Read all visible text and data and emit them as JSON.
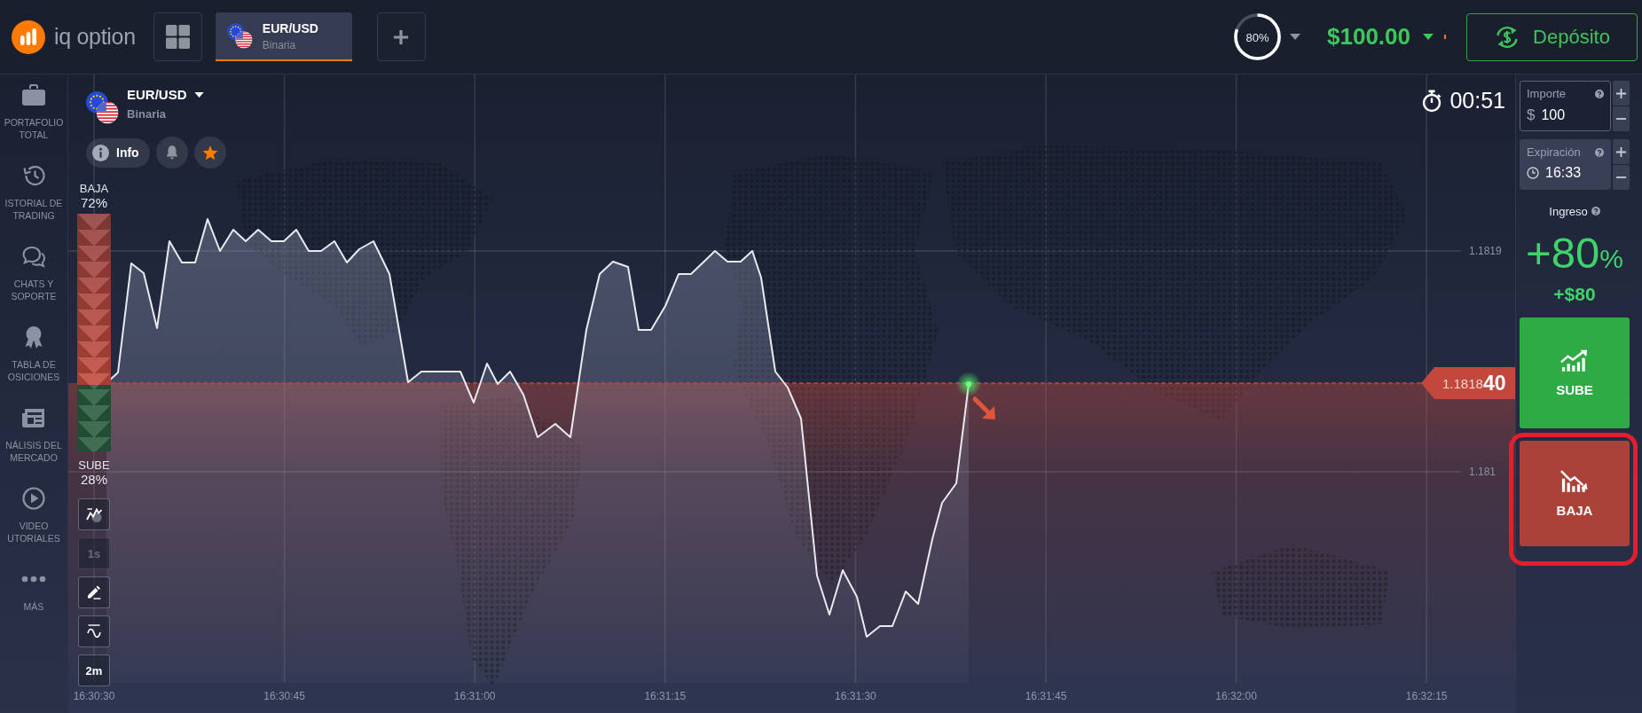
{
  "topbar": {
    "logo": "iq option",
    "tabs": [
      {
        "pair": "EUR/USD",
        "type": "Binaria",
        "selected": true
      }
    ],
    "ring": {
      "label": "80%",
      "level": 0.8
    },
    "balance": "$100.00",
    "deposit_button": "Depósito"
  },
  "sidebar": {
    "items": [
      {
        "label": "PORTAFOLIO\nTOTAL"
      },
      {
        "label": "ISTORIAL DE\nTRADING"
      },
      {
        "label": "CHATS Y\nSOPORTE"
      },
      {
        "label": "TABLA DE\nOSICIONES"
      },
      {
        "label": "NÁLISIS DEL\nMERCADO"
      },
      {
        "label": "VIDEO\nUTORIALES"
      },
      {
        "label": "MÁS"
      }
    ]
  },
  "asset": {
    "pair": "EUR/USD",
    "type": "Binaria",
    "info_button": "Info",
    "favorite": true
  },
  "countdown": "00:51",
  "sentiment": {
    "down_label": "BAJA",
    "down_share": "72%",
    "up_label": "SUBE",
    "up_share": "28%",
    "level": 0.72
  },
  "chart_tools": [
    {
      "kind": "chart_type",
      "disabled": false
    },
    {
      "kind": "text",
      "label": "1s",
      "disabled": true
    },
    {
      "kind": "drawing",
      "disabled": false
    },
    {
      "kind": "indicators",
      "disabled": false
    },
    {
      "kind": "text",
      "label": "2m",
      "disabled": false
    }
  ],
  "chart": {
    "price_labels": [
      "1.1819",
      "1.181"
    ],
    "current_price": "1.1818**40**",
    "time_labels": [
      "16:30:30",
      "16:30:45",
      "16:31:00",
      "16:31:15",
      "16:31:30",
      "16:31:45",
      "16:32:00",
      "16:32:15"
    ]
  },
  "trade_panel": {
    "amount": {
      "label": "Importe",
      "currency": "$",
      "value": "100",
      "focused": true
    },
    "expiry": {
      "label": "Expiración",
      "value": "16:33",
      "focused": false
    },
    "income": {
      "label": "Ingreso",
      "percent": "+80",
      "percent_sign": "%",
      "profit": "+$80"
    },
    "buttons": [
      {
        "kind": "up",
        "label": "SUBE",
        "highlighted": false
      },
      {
        "kind": "down",
        "label": "BAJA",
        "highlighted": true
      }
    ]
  }
}
